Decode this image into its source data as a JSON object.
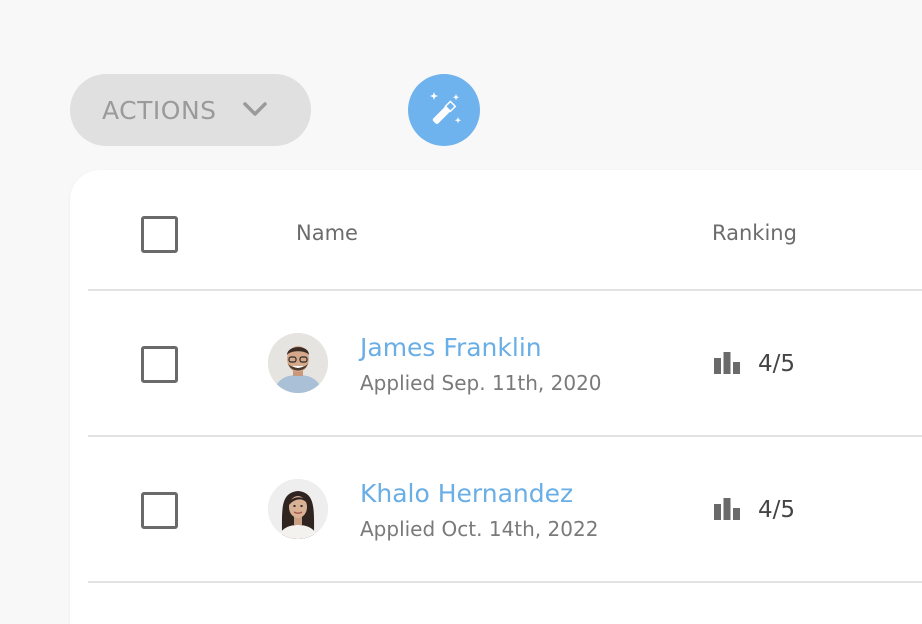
{
  "toolbar": {
    "actions_label": "ACTIONS",
    "actions_icon": "chevron-down-icon",
    "magic_icon": "magic-wand-icon",
    "magic_color": "#6eb2ee"
  },
  "table": {
    "headers": {
      "name": "Name",
      "ranking": "Ranking"
    },
    "rows": [
      {
        "name": "James Franklin",
        "applied": "Applied Sep. 11th, 2020",
        "ranking": "4/5"
      },
      {
        "name": "Khalo Hernandez",
        "applied": "Applied Oct. 14th, 2022",
        "ranking": "4/5"
      }
    ]
  },
  "colors": {
    "link": "#6aaee6",
    "muted": "#7a7a7a"
  }
}
